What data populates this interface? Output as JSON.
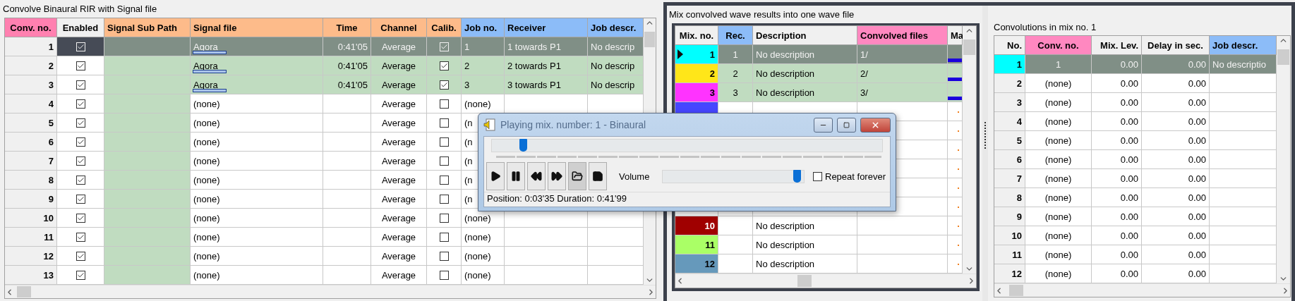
{
  "left_panel": {
    "title": "Convolve Binaural RIR with Signal file",
    "columns": [
      {
        "label": "Conv. no.",
        "color": "#ff80b0"
      },
      {
        "label": "Enabled",
        "color": "#f0f0f0"
      },
      {
        "label": "Signal Sub Path",
        "color": "#fdbb8a"
      },
      {
        "label": "Signal file",
        "color": "#fdbb8a"
      },
      {
        "label": "Time",
        "color": "#fdbb8a"
      },
      {
        "label": "Channel",
        "color": "#fdbb8a"
      },
      {
        "label": "Calib.",
        "color": "#fdbb8a"
      },
      {
        "label": "Job no.",
        "color": "#8cbcf8"
      },
      {
        "label": "Receiver",
        "color": "#8cbcf8"
      },
      {
        "label": "Job descr.",
        "color": "#8cbcf8"
      }
    ],
    "rows": [
      {
        "no": "1",
        "enabled": true,
        "signal_file": "Agora",
        "loaded": true,
        "time": "0:41'05",
        "channel": "Average",
        "calib": true,
        "job_no": "1",
        "receiver": "1 towards P1",
        "job_descr": "No descrip",
        "selected": true,
        "highlighted": true
      },
      {
        "no": "2",
        "enabled": true,
        "signal_file": "Agora",
        "loaded": true,
        "time": "0:41'05",
        "channel": "Average",
        "calib": true,
        "job_no": "2",
        "receiver": "2 towards P1",
        "job_descr": "No descrip",
        "selected": false,
        "highlighted": true
      },
      {
        "no": "3",
        "enabled": true,
        "signal_file": "Agora",
        "loaded": true,
        "time": "0:41'05",
        "channel": "Average",
        "calib": true,
        "job_no": "3",
        "receiver": "3 towards P1",
        "job_descr": "No descrip",
        "selected": false,
        "highlighted": true
      },
      {
        "no": "4",
        "enabled": true,
        "signal_file": "(none)",
        "loaded": false,
        "channel": "Average",
        "calib": false,
        "job_no": "(none)",
        "selected": false,
        "highlighted": false
      },
      {
        "no": "5",
        "enabled": true,
        "signal_file": "(none)",
        "loaded": false,
        "channel": "Average",
        "calib": false,
        "job_no": "(n",
        "selected": false,
        "highlighted": false
      },
      {
        "no": "6",
        "enabled": true,
        "signal_file": "(none)",
        "loaded": false,
        "channel": "Average",
        "calib": false,
        "job_no": "(n",
        "selected": false,
        "highlighted": false
      },
      {
        "no": "7",
        "enabled": true,
        "signal_file": "(none)",
        "loaded": false,
        "channel": "Average",
        "calib": false,
        "job_no": "(n",
        "selected": false,
        "highlighted": false
      },
      {
        "no": "8",
        "enabled": true,
        "signal_file": "(none)",
        "loaded": false,
        "channel": "Average",
        "calib": false,
        "job_no": "(n",
        "selected": false,
        "highlighted": false
      },
      {
        "no": "9",
        "enabled": true,
        "signal_file": "(none)",
        "loaded": false,
        "channel": "Average",
        "calib": false,
        "job_no": "(n",
        "selected": false,
        "highlighted": false
      },
      {
        "no": "10",
        "enabled": true,
        "signal_file": "(none)",
        "loaded": false,
        "channel": "Average",
        "calib": false,
        "job_no": "(none)",
        "selected": false,
        "highlighted": false
      },
      {
        "no": "11",
        "enabled": true,
        "signal_file": "(none)",
        "loaded": false,
        "channel": "Average",
        "calib": false,
        "job_no": "(none)",
        "selected": false,
        "highlighted": false
      },
      {
        "no": "12",
        "enabled": true,
        "signal_file": "(none)",
        "loaded": false,
        "channel": "Average",
        "calib": false,
        "job_no": "(none)",
        "selected": false,
        "highlighted": false
      },
      {
        "no": "13",
        "enabled": true,
        "signal_file": "(none)",
        "loaded": false,
        "channel": "Average",
        "calib": false,
        "job_no": "(none)",
        "selected": false,
        "highlighted": false
      }
    ]
  },
  "mix_panel": {
    "title": "Mix convolved wave results into one wave file",
    "columns": [
      {
        "label": "Mix. no.",
        "color": "#f0f0f0"
      },
      {
        "label": "Rec.",
        "color": "#8cbcf8"
      },
      {
        "label": "Description",
        "color": "#f0f0f0"
      },
      {
        "label": "Convolved files",
        "color": "#ff88c0"
      },
      {
        "label": "Ma",
        "color": "#f0f0f0"
      }
    ],
    "rows": [
      {
        "no": "1",
        "color": "#00ffff",
        "current": true,
        "rec": "1",
        "description": "No description",
        "files": "1/",
        "kind": "bar",
        "selected": true,
        "highlighted": true
      },
      {
        "no": "2",
        "color": "#ffe619",
        "current": false,
        "rec": "2",
        "description": "No description",
        "files": "2/",
        "kind": "bar",
        "selected": false,
        "highlighted": true
      },
      {
        "no": "3",
        "color": "#ff33ff",
        "current": false,
        "rec": "3",
        "description": "No description",
        "files": "3/",
        "kind": "bar",
        "selected": false,
        "highlighted": true
      },
      {
        "color": "#4646ff",
        "current": false,
        "kind": "dot",
        "selected": false,
        "highlighted": false
      },
      {
        "kind": "dot",
        "selected": false,
        "highlighted": false
      },
      {
        "kind": "dot",
        "selected": false,
        "highlighted": false
      },
      {
        "kind": "dot",
        "selected": false,
        "highlighted": false
      },
      {
        "kind": "dot",
        "selected": false,
        "highlighted": false
      },
      {
        "kind": "dot",
        "selected": false,
        "highlighted": false
      },
      {
        "no": "10",
        "color": "#a00000",
        "current": false,
        "description": "No description",
        "kind": "dot",
        "selected": false,
        "highlighted": false
      },
      {
        "no": "11",
        "color": "#aaff66",
        "current": false,
        "description": "No description",
        "kind": "dot",
        "selected": false,
        "highlighted": false
      },
      {
        "no": "12",
        "color": "#6699bb",
        "current": false,
        "description": "No description",
        "kind": "dot",
        "selected": false,
        "highlighted": false
      }
    ]
  },
  "convolutions_panel": {
    "title": "Convolutions in mix no. 1",
    "columns": [
      {
        "label": "No.",
        "color": "#f0f0f0"
      },
      {
        "label": "Conv. no.",
        "color": "#ff88c0"
      },
      {
        "label": "Mix. Lev.",
        "color": "#f0f0f0"
      },
      {
        "label": "Delay in sec.",
        "color": "#f0f0f0"
      },
      {
        "label": "Job descr.",
        "color": "#8cbcf8"
      }
    ],
    "rows": [
      {
        "no": "1",
        "color": "#00ffff",
        "conv_no": "1",
        "mix_lev": "0.00",
        "delay": "0.00",
        "job_descr": "No descriptio",
        "selected": true
      },
      {
        "no": "2",
        "conv_no": "(none)",
        "mix_lev": "0.00",
        "delay": "0.00",
        "selected": false
      },
      {
        "no": "3",
        "conv_no": "(none)",
        "mix_lev": "0.00",
        "delay": "0.00",
        "selected": false
      },
      {
        "no": "4",
        "conv_no": "(none)",
        "mix_lev": "0.00",
        "delay": "0.00",
        "selected": false
      },
      {
        "no": "5",
        "conv_no": "(none)",
        "mix_lev": "0.00",
        "delay": "0.00",
        "selected": false
      },
      {
        "no": "6",
        "conv_no": "(none)",
        "mix_lev": "0.00",
        "delay": "0.00",
        "selected": false
      },
      {
        "no": "7",
        "conv_no": "(none)",
        "mix_lev": "0.00",
        "delay": "0.00",
        "selected": false
      },
      {
        "no": "8",
        "conv_no": "(none)",
        "mix_lev": "0.00",
        "delay": "0.00",
        "selected": false
      },
      {
        "no": "9",
        "conv_no": "(none)",
        "mix_lev": "0.00",
        "delay": "0.00",
        "selected": false
      },
      {
        "no": "10",
        "conv_no": "(none)",
        "mix_lev": "0.00",
        "delay": "0.00",
        "selected": false
      },
      {
        "no": "11",
        "conv_no": "(none)",
        "mix_lev": "0.00",
        "delay": "0.00",
        "selected": false
      },
      {
        "no": "12",
        "conv_no": "(none)",
        "mix_lev": "0.00",
        "delay": "0.00",
        "selected": false
      }
    ]
  },
  "player": {
    "title": "Playing mix. number: 1 - Binaural",
    "position": {
      "level": 0.08
    },
    "buttons": [
      {
        "kind": "play",
        "pressed": false
      },
      {
        "kind": "pause",
        "pressed": false
      },
      {
        "kind": "rewind",
        "pressed": false
      },
      {
        "kind": "forward",
        "pressed": false
      },
      {
        "kind": "open",
        "pressed": true
      },
      {
        "kind": "save",
        "pressed": false
      }
    ],
    "volume": {
      "label": "Volume",
      "level": 0.95
    },
    "repeat": {
      "label": "Repeat forever",
      "checked": false
    },
    "status": "Position: 0:03'35 Duration: 0:41'99"
  }
}
